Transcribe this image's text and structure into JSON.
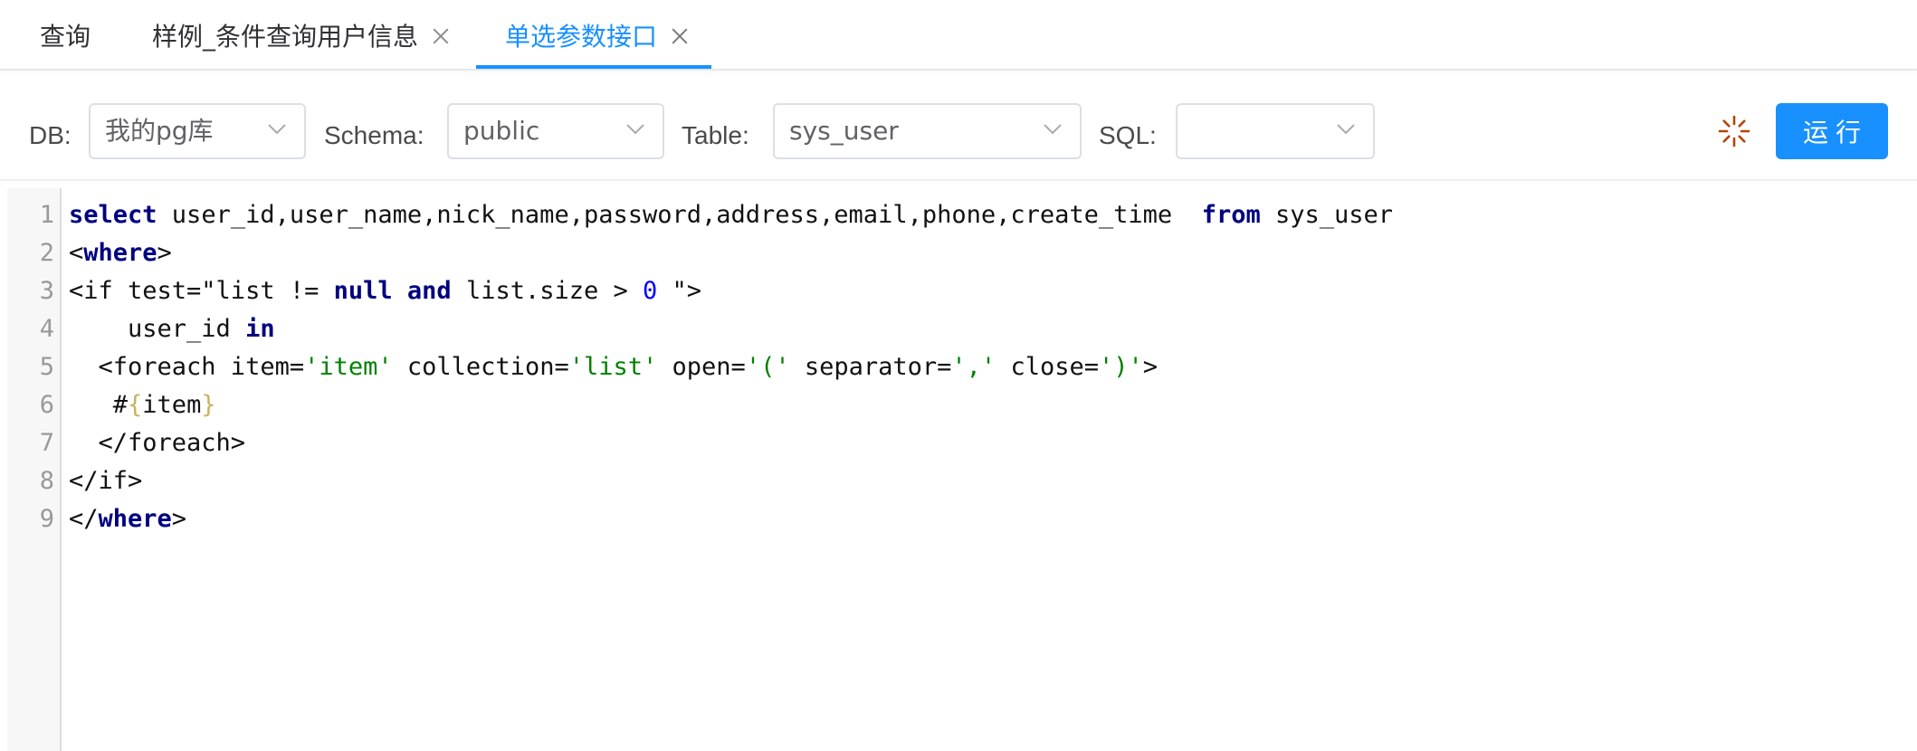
{
  "tabs": [
    {
      "label": "查询",
      "closable": false,
      "active": false
    },
    {
      "label": "样例_条件查询用户信息",
      "closable": true,
      "active": false
    },
    {
      "label": "单选参数接口",
      "closable": true,
      "active": true
    }
  ],
  "toolbar": {
    "db_label": "DB:",
    "db_value": "我的pg库",
    "schema_label": "Schema:",
    "schema_value": "public",
    "table_label": "Table:",
    "table_value": "sys_user",
    "sql_label": "SQL:",
    "sql_value": "",
    "run_label": "运行",
    "loading_icon": "spinner-icon",
    "accent_color": "#1890ff",
    "spinner_color": "#b4460a"
  },
  "editor": {
    "line_numbers": [
      "1",
      "2",
      "3",
      "4",
      "5",
      "6",
      "7",
      "8",
      "9"
    ],
    "lines": {
      "l1": {
        "kw1": "select",
        "t1": " user_id,user_name,nick_name,password,address,email,phone,create_time  ",
        "kw2": "from",
        "t2": " sys_user"
      },
      "l2": {
        "t1": "<",
        "kw1": "where",
        "t2": ">"
      },
      "l3": {
        "t1": "<if test=\"list != ",
        "kw1": "null",
        "t2": " ",
        "kw2": "and",
        "t3": " list.size > ",
        "n1": "0",
        "t4": " \">"
      },
      "l4": {
        "t1": "    user_id ",
        "kw1": "in"
      },
      "l5": {
        "t1": "  <foreach item=",
        "s1": "'item'",
        "t2": " collection=",
        "s2": "'list'",
        "t3": " open=",
        "s3": "'('",
        "t4": " separator=",
        "s4": "','",
        "t5": " close=",
        "s5": "')'",
        "t6": ">"
      },
      "l6": {
        "t1": "   #",
        "b1": "{",
        "t2": "item",
        "b2": "}"
      },
      "l7": {
        "t1": "  </foreach>"
      },
      "l8": {
        "t1": "</if>"
      },
      "l9": {
        "t1": "</",
        "kw1": "where",
        "t2": ">"
      }
    }
  }
}
